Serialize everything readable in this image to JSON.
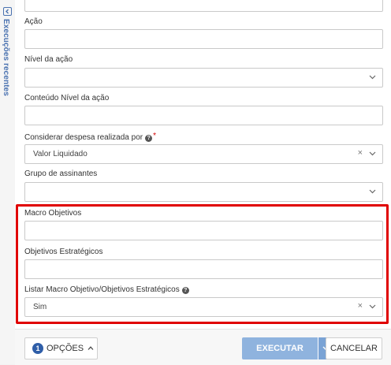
{
  "sidebar": {
    "recent_label": "Execuções recentes",
    "icon": "sidebar-panel-icon"
  },
  "form": {
    "acao": {
      "label": "Ação",
      "value": ""
    },
    "nivel_acao": {
      "label": "Nível da ação",
      "value": ""
    },
    "conteudo_nivel": {
      "label": "Conteúdo Nível da ação",
      "value": ""
    },
    "despesa": {
      "label": "Considerar despesa realizada por",
      "required_mark": "*",
      "help": "?",
      "value": "Valor Liquidado",
      "clear": "×"
    },
    "assinantes": {
      "label": "Grupo de assinantes",
      "value": ""
    },
    "macro_objetivos": {
      "label": "Macro Objetivos",
      "value": ""
    },
    "objetivos_estrategicos": {
      "label": "Objetivos Estratégicos",
      "value": ""
    },
    "listar": {
      "label": "Listar Macro Objetivo/Objetivos Estratégicos",
      "help": "?",
      "value": "Sim",
      "clear": "×"
    }
  },
  "footer": {
    "options_count": "1",
    "options_label": "OPÇÕES",
    "execute_label": "EXECUTAR",
    "cancel_label": "CANCELAR"
  },
  "colors": {
    "highlight": "#e00000",
    "primary": "#8fb3de",
    "badge": "#2f5ea8",
    "sidebar_text": "#4a72b0"
  }
}
